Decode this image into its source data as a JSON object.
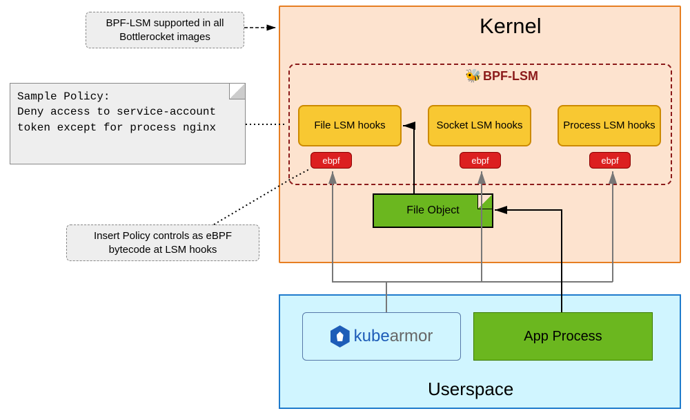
{
  "kernel": {
    "title": "Kernel"
  },
  "bpflsm": {
    "label": "BPF-LSM",
    "hooks": {
      "file": "File LSM hooks",
      "socket": "Socket LSM hooks",
      "process": "Process LSM hooks"
    },
    "badge": "ebpf"
  },
  "file_object": {
    "label": "File Object"
  },
  "notes": {
    "top": "BPF-LSM supported in all Bottlerocket images",
    "policy": "Sample Policy:\nDeny access to service-account token except for process nginx",
    "bottom": "Insert Policy controls as eBPF bytecode at LSM hooks"
  },
  "userspace": {
    "title": "Userspace",
    "kubearmor_kube": "kube",
    "kubearmor_armor": "armor",
    "app_process": "App Process"
  }
}
